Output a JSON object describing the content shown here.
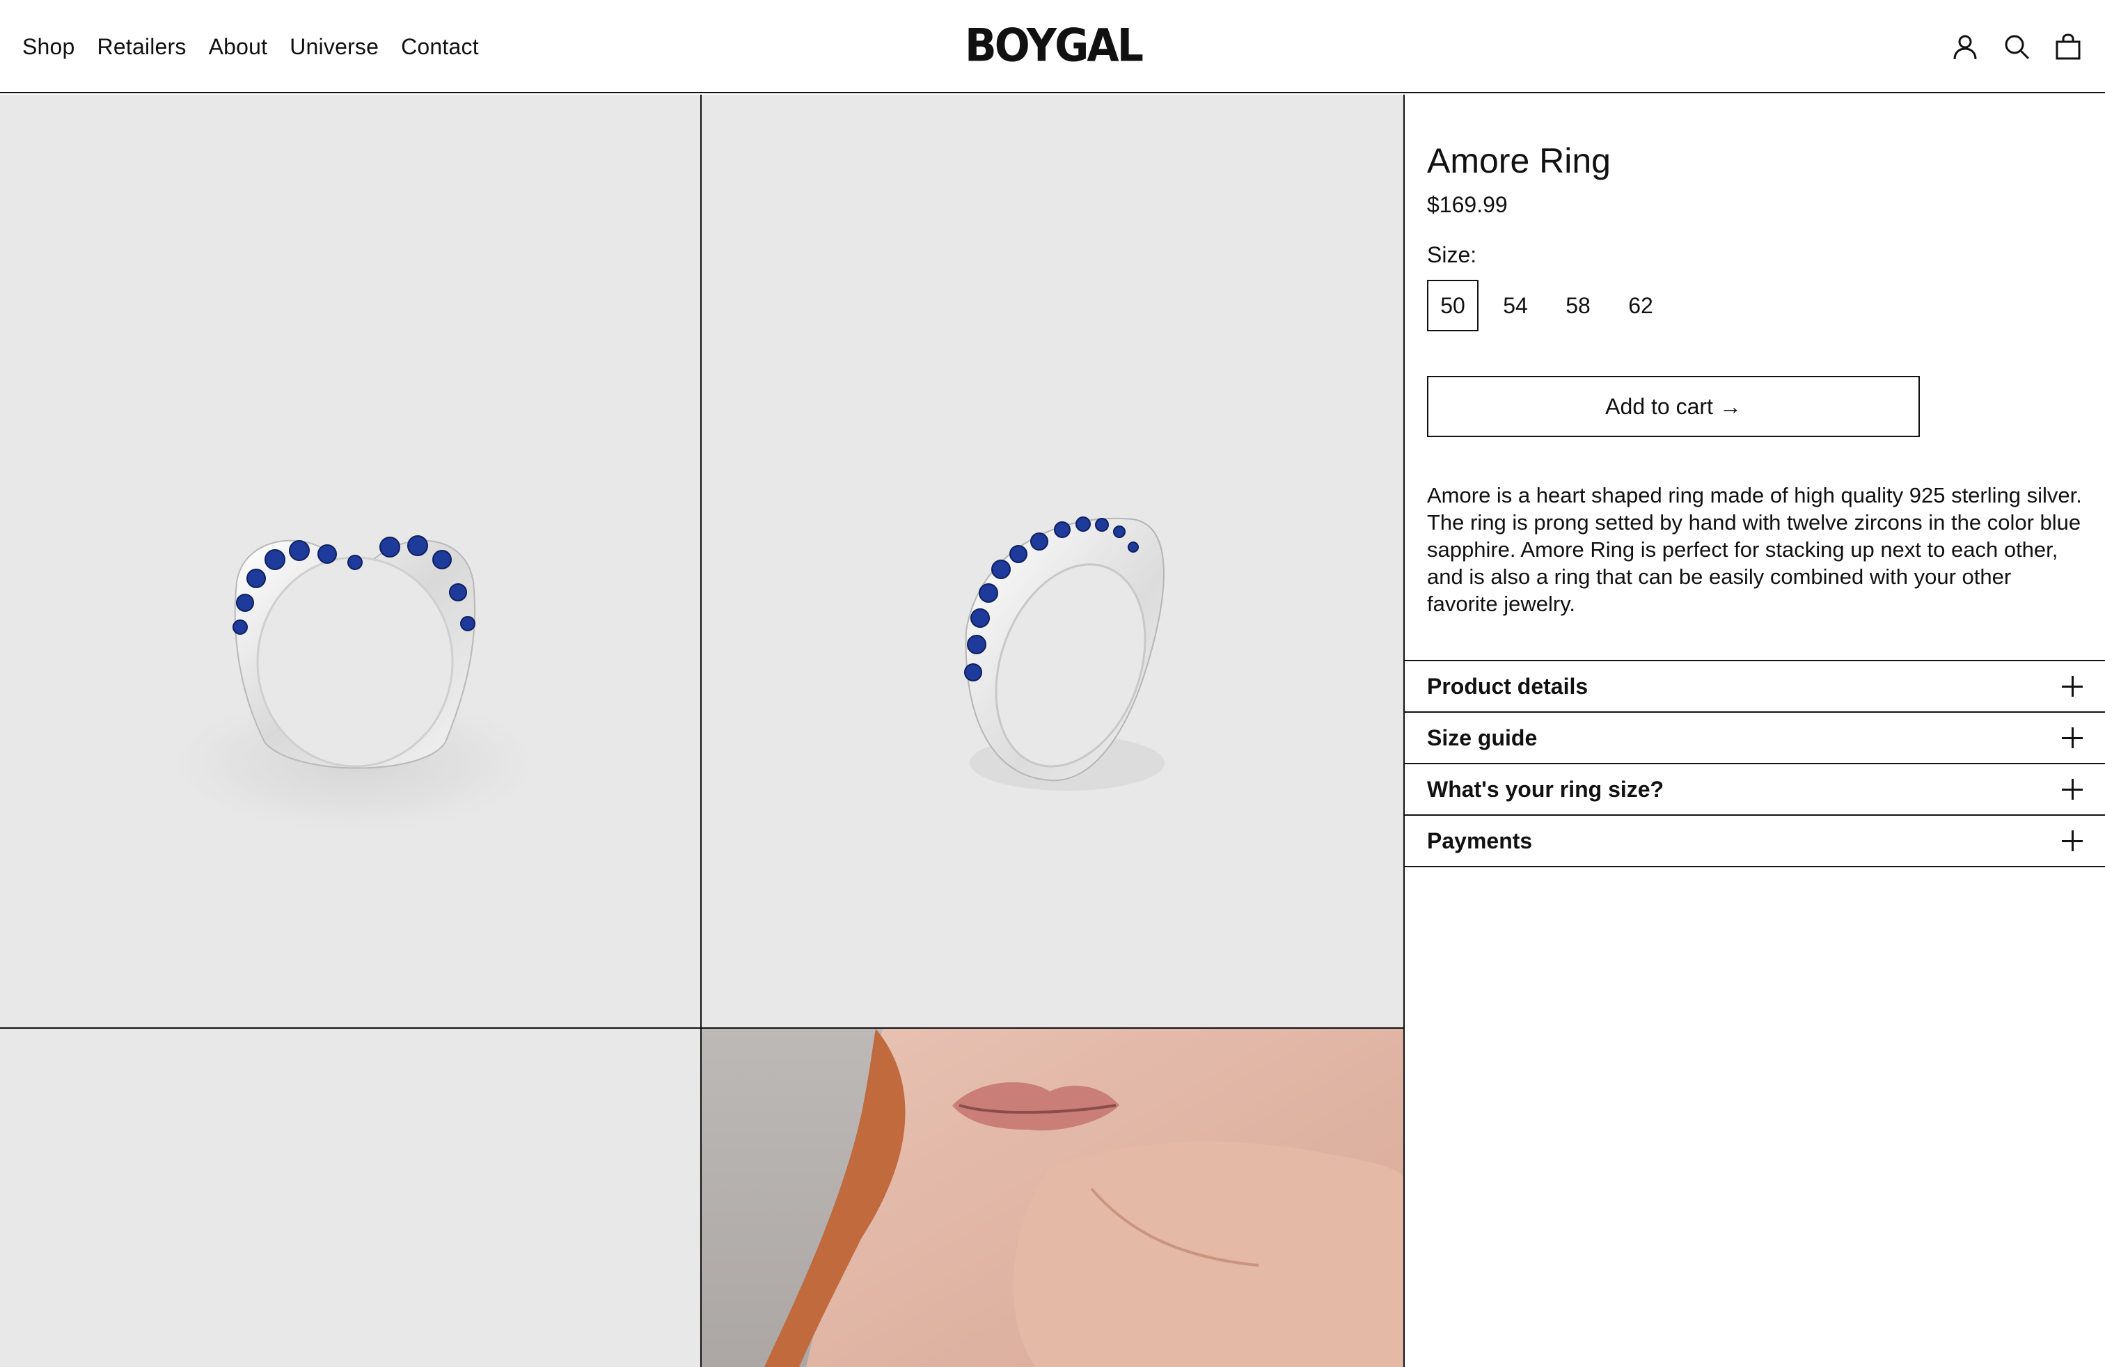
{
  "header": {
    "nav": [
      "Shop",
      "Retailers",
      "About",
      "Universe",
      "Contact"
    ],
    "logo": "BOYGAL",
    "icons": [
      "account-icon",
      "search-icon",
      "cart-icon"
    ]
  },
  "gallery": {
    "images": [
      "ring-front-view",
      "ring-angle-view",
      "blank-image",
      "model-lips-hand"
    ]
  },
  "product": {
    "title": "Amore Ring",
    "price": "$169.99",
    "size_label": "Size:",
    "sizes": [
      "50",
      "54",
      "58",
      "62"
    ],
    "selected_size": "50",
    "add_to_cart": "Add to cart →",
    "description": "Amore is a heart shaped ring made of high quality 925 sterling silver. The ring is prong setted by hand with twelve zircons in the color blue sapphire. Amore Ring is perfect for stacking up next to each other, and is also a ring that can be easily combined with your other favorite jewelry.",
    "accordions": [
      "Product details",
      "Size guide",
      "What's your ring size?",
      "Payments"
    ]
  },
  "colors": {
    "background": "#ffffff",
    "tile": "#e8e8e8",
    "text": "#111111",
    "sapphire": "#1e3a9a"
  }
}
